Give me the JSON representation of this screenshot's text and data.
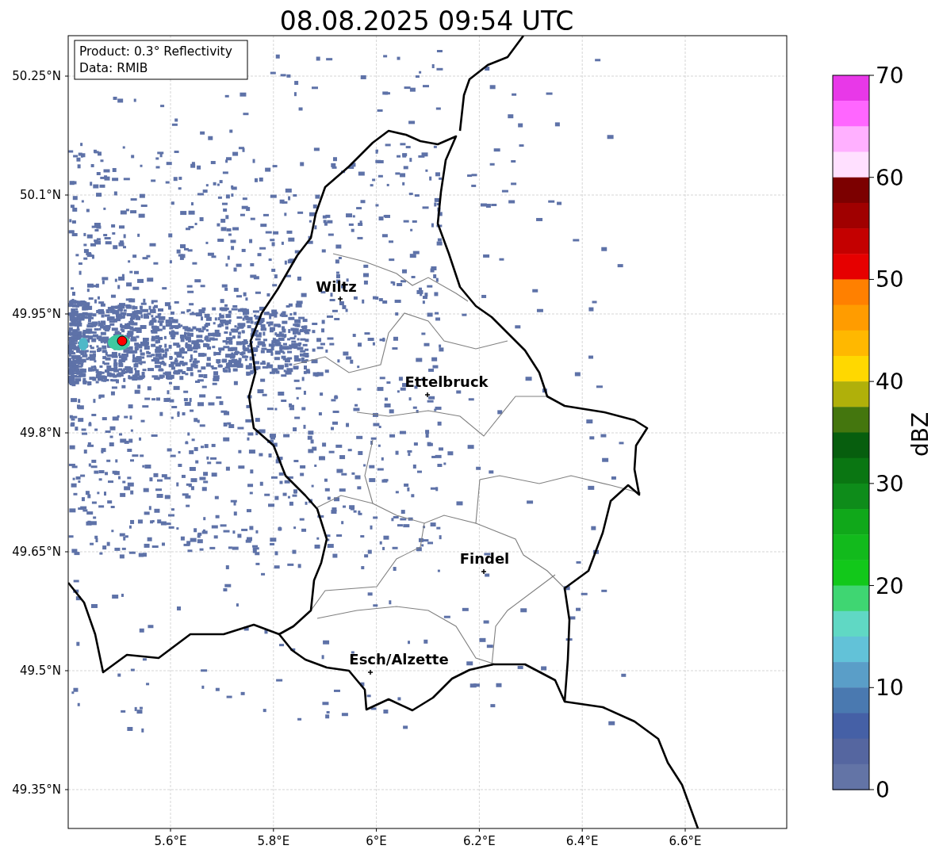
{
  "title": "08.08.2025 09:54 UTC",
  "info_box": {
    "lines": [
      "Product: 0.3° Reflectivity",
      "Data: RMIB"
    ]
  },
  "map": {
    "y_ticks": [
      "50.25°N",
      "50.1°N",
      "49.95°N",
      "49.8°N",
      "49.65°N",
      "49.5°N",
      "49.35°N"
    ],
    "x_ticks": [
      "5.6°E",
      "5.8°E",
      "6°E",
      "6.2°E",
      "6.4°E",
      "6.6°E"
    ],
    "cities": [
      {
        "name": "Wiltz"
      },
      {
        "name": "Ettelbruck"
      },
      {
        "name": "Findel"
      },
      {
        "name": "Esch/Alzette"
      }
    ]
  },
  "colorbar": {
    "label": "dBZ",
    "ticks": [
      "70",
      "60",
      "50",
      "40",
      "30",
      "20",
      "10",
      "0"
    ],
    "segments": [
      {
        "color": "#e838e8"
      },
      {
        "color": "#ff66ff"
      },
      {
        "color": "#ffb0ff"
      },
      {
        "color": "#ffe0ff"
      },
      {
        "color": "#7c0000"
      },
      {
        "color": "#a00000"
      },
      {
        "color": "#c40000"
      },
      {
        "color": "#e60000"
      },
      {
        "color": "#ff8000"
      },
      {
        "color": "#ff9c00"
      },
      {
        "color": "#ffb800"
      },
      {
        "color": "#ffd800"
      },
      {
        "color": "#b0b00a"
      },
      {
        "color": "#44760e"
      },
      {
        "color": "#075e0e"
      },
      {
        "color": "#0a7612"
      },
      {
        "color": "#0e8c1a"
      },
      {
        "color": "#10a81a"
      },
      {
        "color": "#12ba1c"
      },
      {
        "color": "#12c81a"
      },
      {
        "color": "#3fd672"
      },
      {
        "color": "#60d8c4"
      },
      {
        "color": "#62c2d8"
      },
      {
        "color": "#5a9ec8"
      },
      {
        "color": "#4a79b0"
      },
      {
        "color": "#4560a6"
      },
      {
        "color": "#5566a0"
      },
      {
        "color": "#6374a6"
      }
    ]
  }
}
